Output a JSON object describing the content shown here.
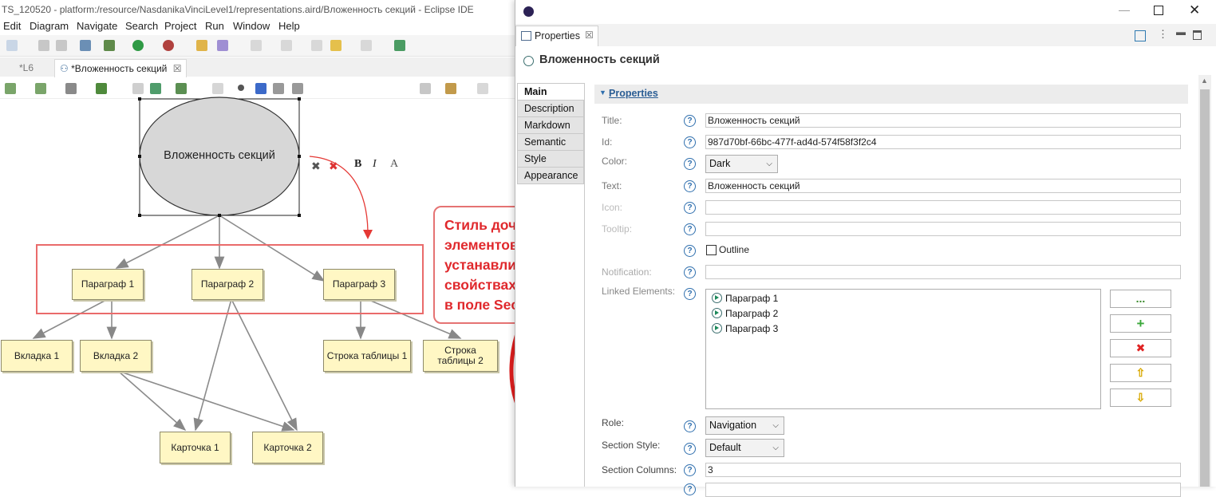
{
  "eclipse": {
    "title": "TS_120520 - platform:/resource/NasdanikaVinciLevel1/representations.aird/Вложенность секций - Eclipse IDE",
    "menu": [
      "Edit",
      "Diagram",
      "Navigate",
      "Search",
      "Project",
      "Run",
      "Window",
      "Help"
    ],
    "editor_tabs": [
      "*L6",
      "*Вложенность секций"
    ]
  },
  "diagram": {
    "root": "Вложенность секций",
    "sections": [
      "Параграф 1",
      "Параграф 2",
      "Параграф 3"
    ],
    "tabs": [
      "Вкладка 1",
      "Вкладка 2"
    ],
    "rows": [
      "Строка таблицы 1",
      "Строка таблицы 2"
    ],
    "cards": [
      "Карточка 1",
      "Карточка 2"
    ],
    "callout_lines": [
      "Стиль дочерних",
      "элементов",
      "устанавливается в",
      "свойствах элемента",
      "в поле Section Style"
    ],
    "callout_color": "#e0282c"
  },
  "properties": {
    "view_tab": "Properties",
    "header_title": "Вложенность секций",
    "side_tabs": [
      "Main",
      "Description",
      "Markdown",
      "Semantic",
      "Style",
      "Appearance"
    ],
    "section_title": "Properties",
    "labels": {
      "title": "Title:",
      "id": "Id:",
      "color": "Color:",
      "text": "Text:",
      "icon": "Icon:",
      "tooltip": "Tooltip:",
      "notification": "Notification:",
      "linked": "Linked Elements:",
      "role": "Role:",
      "section_style": "Section Style:",
      "section_columns": "Section Columns:"
    },
    "values": {
      "title": "Вложенность секций",
      "id": "987d70bf-66bc-477f-ad4d-574f58f3f2c4",
      "color": "Dark",
      "text": "Вложенность секций",
      "icon": "",
      "tooltip": "",
      "outline_label": "Outline",
      "notification": "",
      "role": "Navigation",
      "section_style": "Default",
      "section_columns": "3"
    },
    "linked_elements": [
      "Параграф 1",
      "Параграф 2",
      "Параграф 3"
    ],
    "buttons": {
      "browse": "...",
      "add": "+",
      "remove": "✖",
      "up": "⇧",
      "down": "⇩"
    }
  }
}
